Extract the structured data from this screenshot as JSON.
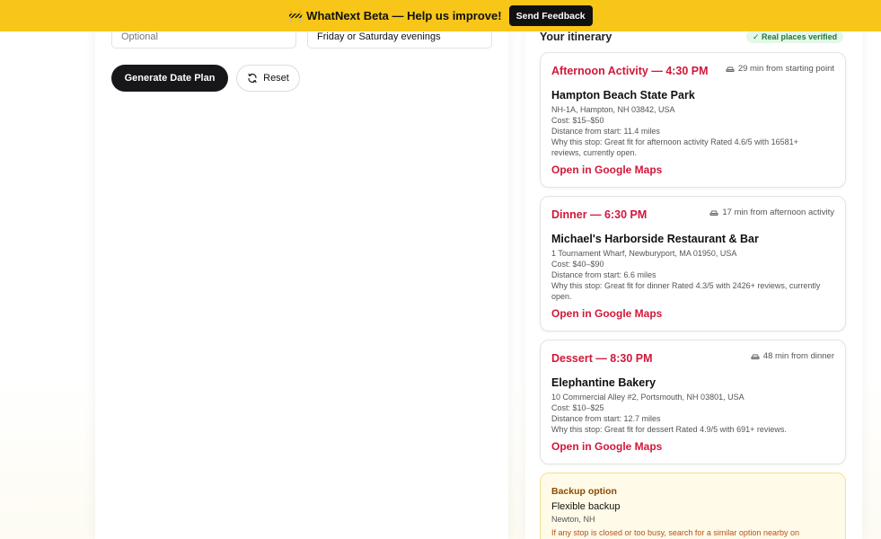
{
  "banner": {
    "emoji": "🚧",
    "text": "WhatNext Beta — Help us improve!",
    "button": "Send Feedback"
  },
  "form": {
    "field_a_placeholder": "Optional",
    "field_b_value": "Friday or Saturday evenings",
    "generate_label": "Generate Date Plan",
    "reset_label": "Reset"
  },
  "itinerary": {
    "title": "Your itinerary",
    "verified_badge": "✓ Real places verified",
    "stops": [
      {
        "heading": "Afternoon Activity — 4:30 PM",
        "travel": "29 min from starting point",
        "name": "Hampton Beach State Park",
        "address": "NH-1A, Hampton, NH 03842, USA",
        "cost": "Cost: $15–$50",
        "distance": "Distance from start: 11.4 miles",
        "why": "Why this stop: Great fit for afternoon activity Rated 4.6/5 with 16581+ reviews, currently open.",
        "link": "Open in Google Maps"
      },
      {
        "heading": "Dinner — 6:30 PM",
        "travel": "17 min from afternoon activity",
        "name": "Michael's Harborside Restaurant & Bar",
        "address": "1 Tournament Wharf, Newburyport, MA 01950, USA",
        "cost": "Cost: $40–$90",
        "distance": "Distance from start: 6.6 miles",
        "why": "Why this stop: Great fit for dinner Rated 4.3/5 with 2426+ reviews, currently open.",
        "link": "Open in Google Maps"
      },
      {
        "heading": "Dessert — 8:30 PM",
        "travel": "48 min from dinner",
        "name": "Elephantine Bakery",
        "address": "10 Commercial Alley #2, Portsmouth, NH 03801, USA",
        "cost": "Cost: $10–$25",
        "distance": "Distance from start: 12.7 miles",
        "why": "Why this stop: Great fit for dessert Rated 4.9/5 with 691+ reviews.",
        "link": "Open in Google Maps"
      }
    ],
    "backup": {
      "label": "Backup option",
      "title": "Flexible backup",
      "place": "Newton, NH",
      "note": "If any stop is closed or too busy, search for a similar option nearby on"
    }
  },
  "colors": {
    "banner": "#f7c619",
    "accent_red": "#d2173a",
    "dark_button": "#17171a",
    "verified_green": "#1f7a3a"
  },
  "icons": {
    "reset": "refresh-icon",
    "travel": "car-icon"
  }
}
